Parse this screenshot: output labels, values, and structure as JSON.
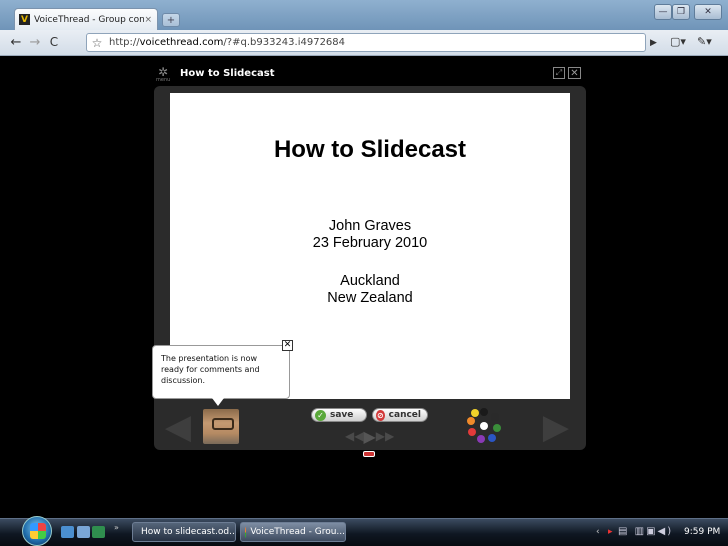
{
  "browser": {
    "tab_title": "VoiceThread - Group con...",
    "tab_close": "×",
    "new_tab": "+",
    "url_prefix": "http://",
    "url_host": "voicethread.com",
    "url_path": "/?#q.b933243.i4972684",
    "window_buttons": {
      "minimize": "—",
      "maximize": "❐",
      "close": "✕"
    }
  },
  "player": {
    "menu_label": "menu",
    "title": "How to Slidecast",
    "slide": {
      "title": "How to Slidecast",
      "author": "John Graves",
      "date": "23 February 2010",
      "city": "Auckland",
      "country": "New Zealand"
    },
    "bubble_text": "The presentation is now ready for comments and discussion.",
    "save_label": "save",
    "cancel_label": "cancel"
  },
  "taskbar": {
    "task_1": "How to slidecast.od...",
    "task_2": "VoiceThread - Grou...",
    "more": "»",
    "clock": "9:59 PM"
  },
  "colors": {
    "background": "#000000",
    "player_frame": "#2b2b2b",
    "save_icon": "#5aa83a",
    "cancel_icon": "#d23a3a"
  }
}
